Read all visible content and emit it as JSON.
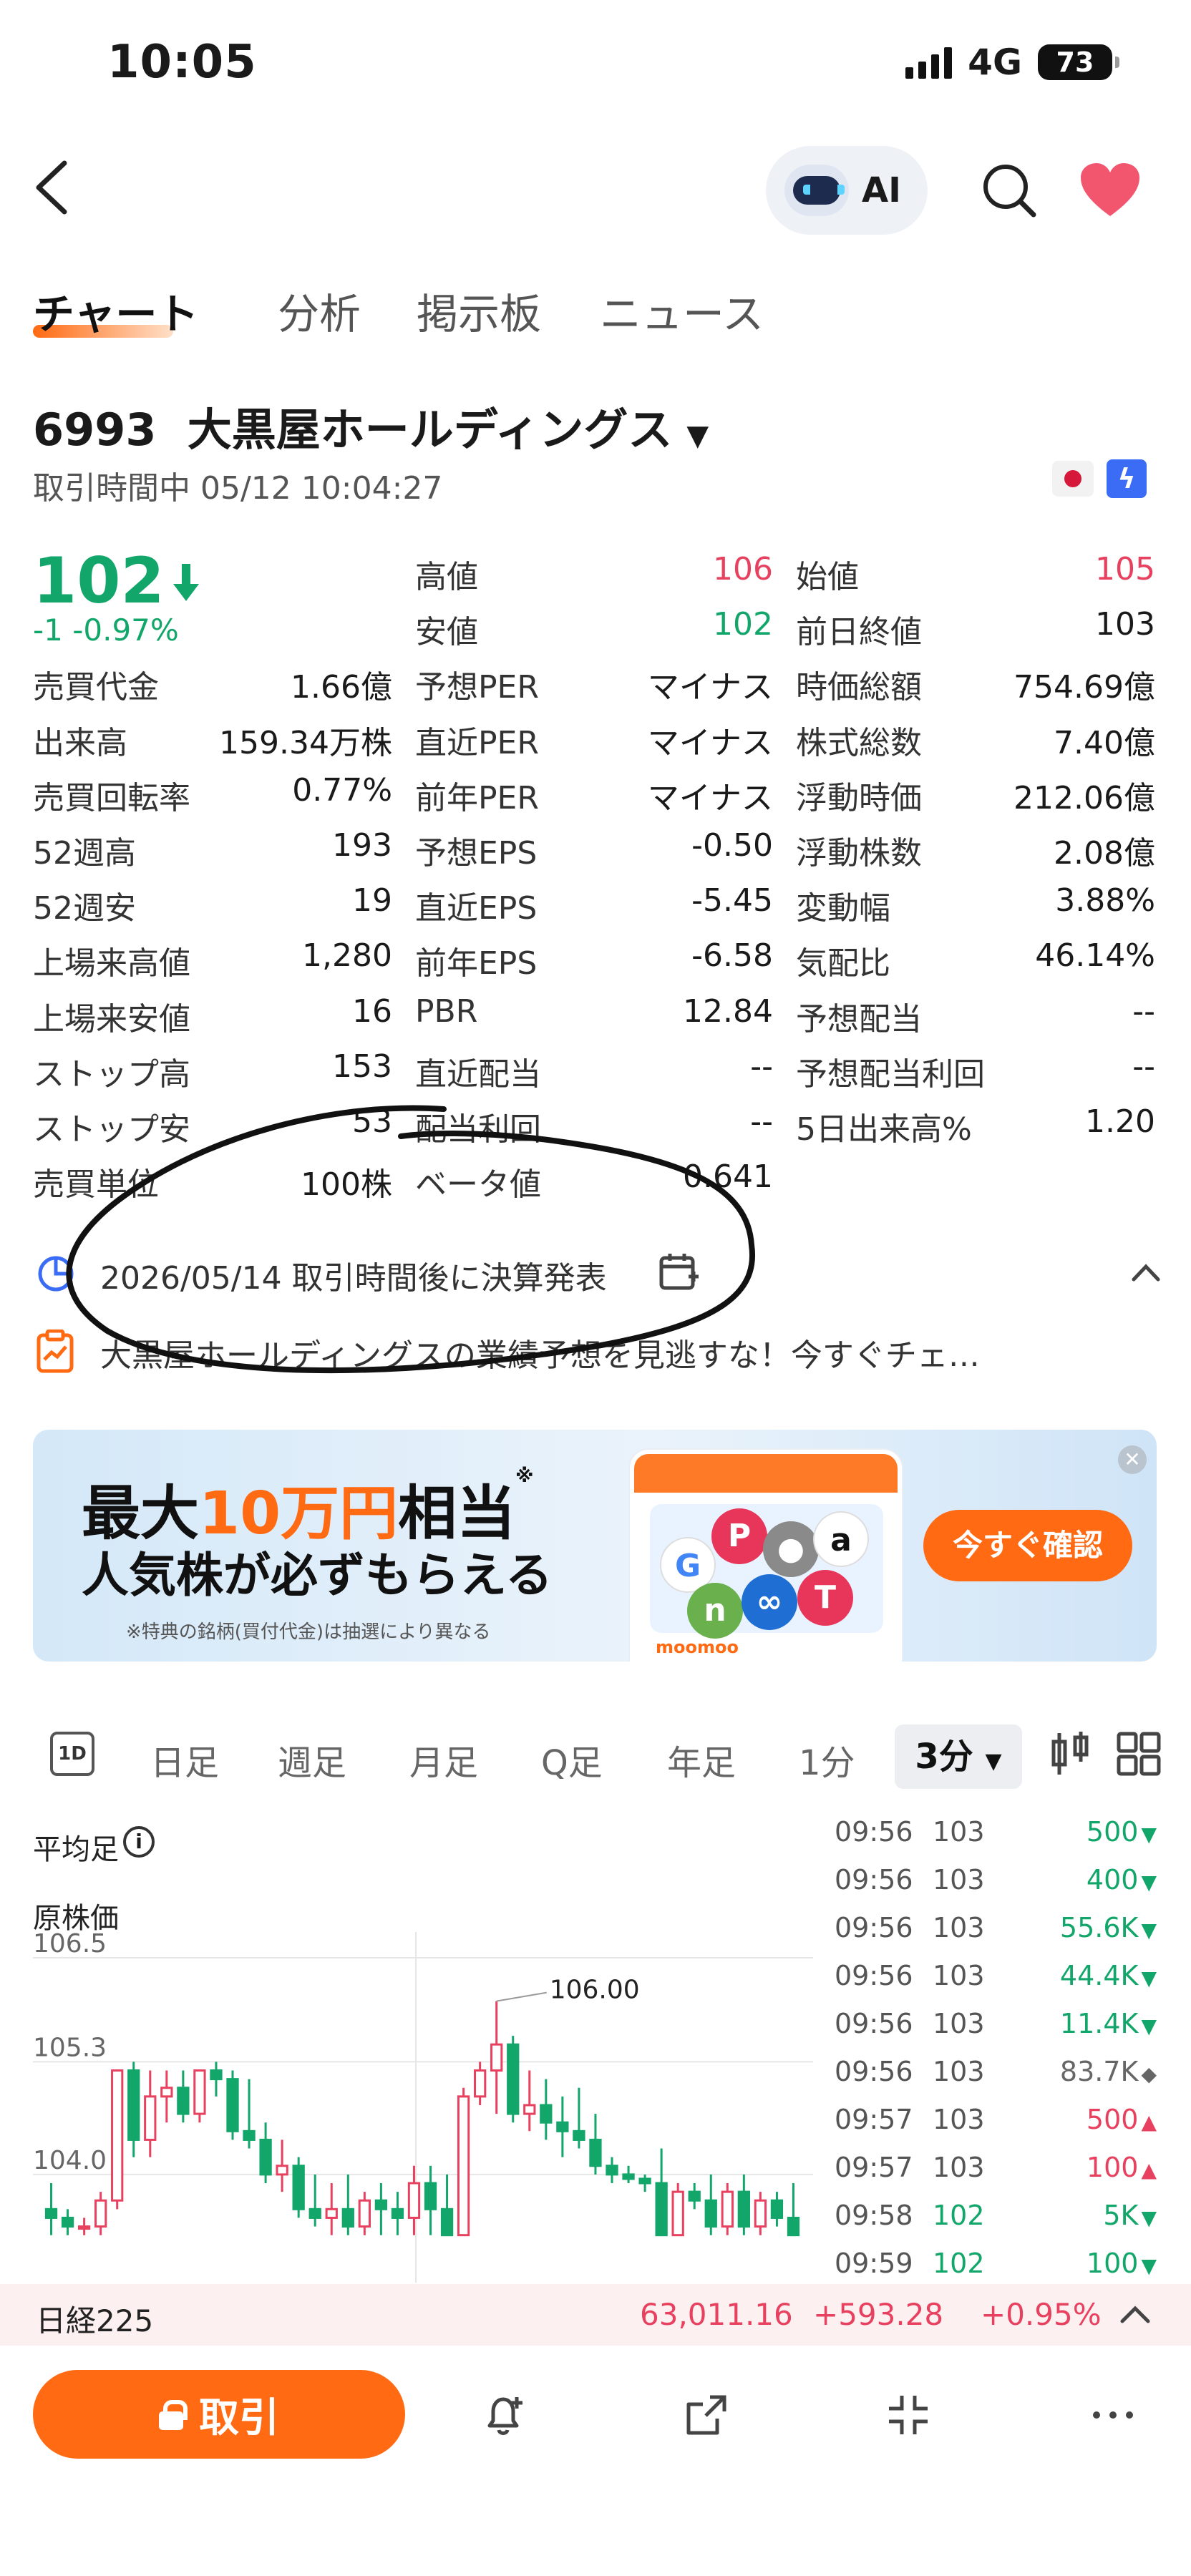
{
  "status_bar": {
    "time": "10:05",
    "network": "4G",
    "battery": "73"
  },
  "nav": {
    "ai_label": "AI"
  },
  "tabs": [
    "チャート",
    "分析",
    "掲示板",
    "ニュース"
  ],
  "stock": {
    "code": "6993",
    "name": "大黒屋ホールディングス",
    "trade_time": "取引時間中 05/12 10:04:27",
    "price": "102",
    "change": "-1 -0.97%"
  },
  "quote_cols": [
    [
      {
        "label": "売買代金",
        "value": "1.66億"
      },
      {
        "label": "出来高",
        "value": "159.34万株"
      },
      {
        "label": "売買回転率",
        "value": "0.77%"
      },
      {
        "label": "52週高",
        "value": "193"
      },
      {
        "label": "52週安",
        "value": "19"
      },
      {
        "label": "上場来高値",
        "value": "1,280"
      },
      {
        "label": "上場来安値",
        "value": "16"
      },
      {
        "label": "ストップ高",
        "value": "153"
      },
      {
        "label": "ストップ安",
        "value": "53"
      },
      {
        "label": "売買単位",
        "value": "100株"
      }
    ],
    [
      {
        "label": "高値",
        "value": "106",
        "color": "red"
      },
      {
        "label": "安値",
        "value": "102",
        "color": "green"
      },
      {
        "label": "予想PER",
        "value": "マイナス"
      },
      {
        "label": "直近PER",
        "value": "マイナス"
      },
      {
        "label": "前年PER",
        "value": "マイナス"
      },
      {
        "label": "予想EPS",
        "value": "-0.50"
      },
      {
        "label": "直近EPS",
        "value": "-5.45"
      },
      {
        "label": "前年EPS",
        "value": "-6.58"
      },
      {
        "label": "PBR",
        "value": "12.84"
      },
      {
        "label": "直近配当",
        "value": "--"
      },
      {
        "label": "配当利回",
        "value": "--"
      },
      {
        "label": "ベータ値",
        "value": "0.641"
      }
    ],
    [
      {
        "label": "始値",
        "value": "105",
        "color": "red"
      },
      {
        "label": "前日終値",
        "value": "103"
      },
      {
        "label": "時価総額",
        "value": "754.69億"
      },
      {
        "label": "株式総数",
        "value": "7.40億"
      },
      {
        "label": "浮動時価",
        "value": "212.06億"
      },
      {
        "label": "浮動株数",
        "value": "2.08億"
      },
      {
        "label": "変動幅",
        "value": "3.88%"
      },
      {
        "label": "気配比",
        "value": "46.14%"
      },
      {
        "label": "予想配当",
        "value": "--"
      },
      {
        "label": "予想配当利回",
        "value": "--"
      },
      {
        "label": "5日出来高%",
        "value": "1.20"
      }
    ]
  ],
  "earnings": {
    "notice": "2026/05/14 取引時間後に決算発表",
    "forecast": "大黒屋ホールディングスの業績予想を見逃すな！今すぐチェ…"
  },
  "banner": {
    "line1_a": "最大",
    "line1_b": "10万円",
    "line1_c": "相当",
    "line1_mark": "※",
    "line2": "人気株が必ずもらえる",
    "note": "※特典の銘柄(買付代金)は抽選により異なる",
    "cta": "今すぐ確認",
    "brand": "moomoo"
  },
  "chart_toolbar": {
    "icon_1d": "1D",
    "items": [
      "日足",
      "週足",
      "月足",
      "Q足",
      "年足",
      "1分"
    ],
    "active": "3分"
  },
  "chart": {
    "avg_label": "平均足",
    "price_label": "原株価",
    "y_labels": [
      "106.5",
      "105.3",
      "104.0"
    ],
    "high_marker": "106.00"
  },
  "chart_data": {
    "type": "candlestick",
    "ylim": [
      103.3,
      106.5
    ],
    "y_ticks": [
      106.5,
      105.3,
      104.0
    ],
    "annotations": [
      {
        "text": "106.00",
        "value": 106.0
      }
    ],
    "candles": [
      [
        103.6,
        103.9,
        103.3,
        103.5
      ],
      [
        103.5,
        103.6,
        103.3,
        103.4
      ],
      [
        103.4,
        103.5,
        103.3,
        103.4
      ],
      [
        103.4,
        103.8,
        103.3,
        103.7
      ],
      [
        103.7,
        105.2,
        103.6,
        105.2
      ],
      [
        105.2,
        105.3,
        104.2,
        104.4
      ],
      [
        104.4,
        105.2,
        104.2,
        104.9
      ],
      [
        104.9,
        105.2,
        104.6,
        105.0
      ],
      [
        105.0,
        105.2,
        104.6,
        104.7
      ],
      [
        104.7,
        105.2,
        104.6,
        105.2
      ],
      [
        105.2,
        105.3,
        104.9,
        105.1
      ],
      [
        105.1,
        105.2,
        104.4,
        104.5
      ],
      [
        104.5,
        105.1,
        104.3,
        104.4
      ],
      [
        104.4,
        104.6,
        103.9,
        104.0
      ],
      [
        104.0,
        104.4,
        103.8,
        104.1
      ],
      [
        104.1,
        104.2,
        103.5,
        103.6
      ],
      [
        103.6,
        104.0,
        103.4,
        103.5
      ],
      [
        103.5,
        103.9,
        103.3,
        103.6
      ],
      [
        103.6,
        104.0,
        103.3,
        103.4
      ],
      [
        103.4,
        103.8,
        103.3,
        103.7
      ],
      [
        103.7,
        103.9,
        103.3,
        103.6
      ],
      [
        103.6,
        103.8,
        103.3,
        103.5
      ],
      [
        103.5,
        104.1,
        103.3,
        103.9
      ],
      [
        103.9,
        104.1,
        103.3,
        103.6
      ],
      [
        103.6,
        104.0,
        103.3,
        103.3
      ],
      [
        103.3,
        105.0,
        103.3,
        104.9
      ],
      [
        104.9,
        105.3,
        104.8,
        105.2
      ],
      [
        105.2,
        106.0,
        104.7,
        105.5
      ],
      [
        105.5,
        105.6,
        104.6,
        104.7
      ],
      [
        104.7,
        105.2,
        104.5,
        104.8
      ],
      [
        104.8,
        105.1,
        104.4,
        104.6
      ],
      [
        104.6,
        104.9,
        104.2,
        104.5
      ],
      [
        104.5,
        105.0,
        104.3,
        104.4
      ],
      [
        104.4,
        104.7,
        104.0,
        104.1
      ],
      [
        104.1,
        104.2,
        103.9,
        104.0
      ],
      [
        104.0,
        104.1,
        103.9,
        103.95
      ],
      [
        103.95,
        104.0,
        103.8,
        103.9
      ],
      [
        103.9,
        104.3,
        103.3,
        103.3
      ],
      [
        103.3,
        103.9,
        103.3,
        103.8
      ],
      [
        103.8,
        103.9,
        103.6,
        103.7
      ],
      [
        103.7,
        104.0,
        103.3,
        103.4
      ],
      [
        103.4,
        103.9,
        103.3,
        103.8
      ],
      [
        103.8,
        104.0,
        103.3,
        103.4
      ],
      [
        103.4,
        103.8,
        103.3,
        103.7
      ],
      [
        103.7,
        103.8,
        103.4,
        103.5
      ],
      [
        103.5,
        103.9,
        103.3,
        103.3
      ]
    ]
  },
  "time_sales": [
    {
      "time": "09:56",
      "price": "103",
      "vol": "500",
      "dir": "down"
    },
    {
      "time": "09:56",
      "price": "103",
      "vol": "400",
      "dir": "down"
    },
    {
      "time": "09:56",
      "price": "103",
      "vol": "55.6K",
      "dir": "down"
    },
    {
      "time": "09:56",
      "price": "103",
      "vol": "44.4K",
      "dir": "down"
    },
    {
      "time": "09:56",
      "price": "103",
      "vol": "11.4K",
      "dir": "down"
    },
    {
      "time": "09:56",
      "price": "103",
      "vol": "83.7K",
      "dir": "neutral"
    },
    {
      "time": "09:57",
      "price": "103",
      "vol": "500",
      "dir": "up"
    },
    {
      "time": "09:57",
      "price": "103",
      "vol": "100",
      "dir": "up"
    },
    {
      "time": "09:58",
      "price": "102",
      "vol": "5K",
      "dir": "down"
    },
    {
      "time": "09:59",
      "price": "102",
      "vol": "100",
      "dir": "down"
    }
  ],
  "index_bar": {
    "name": "日経225",
    "value": "63,011.16",
    "change": "+593.28",
    "pct": "+0.95%"
  },
  "bottom": {
    "trade_label": "取引"
  },
  "colors": {
    "up": "#e8415f",
    "down": "#12a66a",
    "accent": "#ff6a13"
  }
}
